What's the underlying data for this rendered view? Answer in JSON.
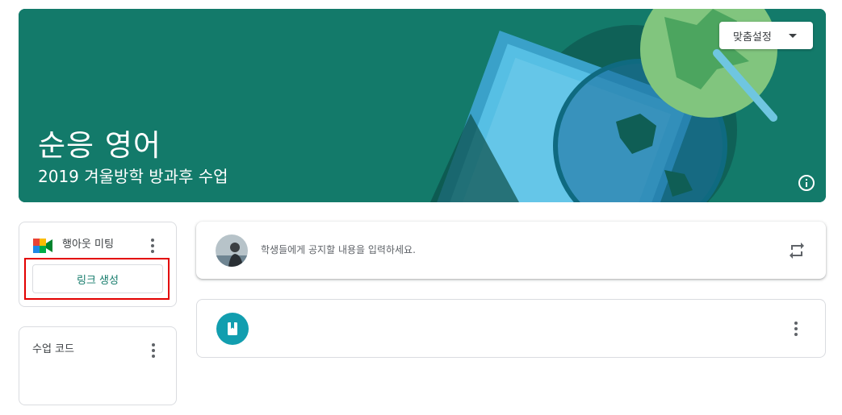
{
  "banner": {
    "title": "순응 영어",
    "subtitle": "2019 겨울방학 방과후 수업",
    "customize_label": "맞춤설정",
    "bg_color": "#137a6a"
  },
  "meet": {
    "title": "행아웃 미팅",
    "link_button_label": "링크 생성",
    "logo_icon": "google-meet-icon"
  },
  "class_code": {
    "title": "수업 코드"
  },
  "announce": {
    "placeholder": "학생들에게 공지할 내용을 입력하세요.",
    "repost_icon": "repost-icon"
  },
  "stream": {
    "item_icon": "book-icon",
    "icon_color": "#129eaf"
  },
  "colors": {
    "accent": "#137a6a",
    "highlight": "#e30000"
  }
}
